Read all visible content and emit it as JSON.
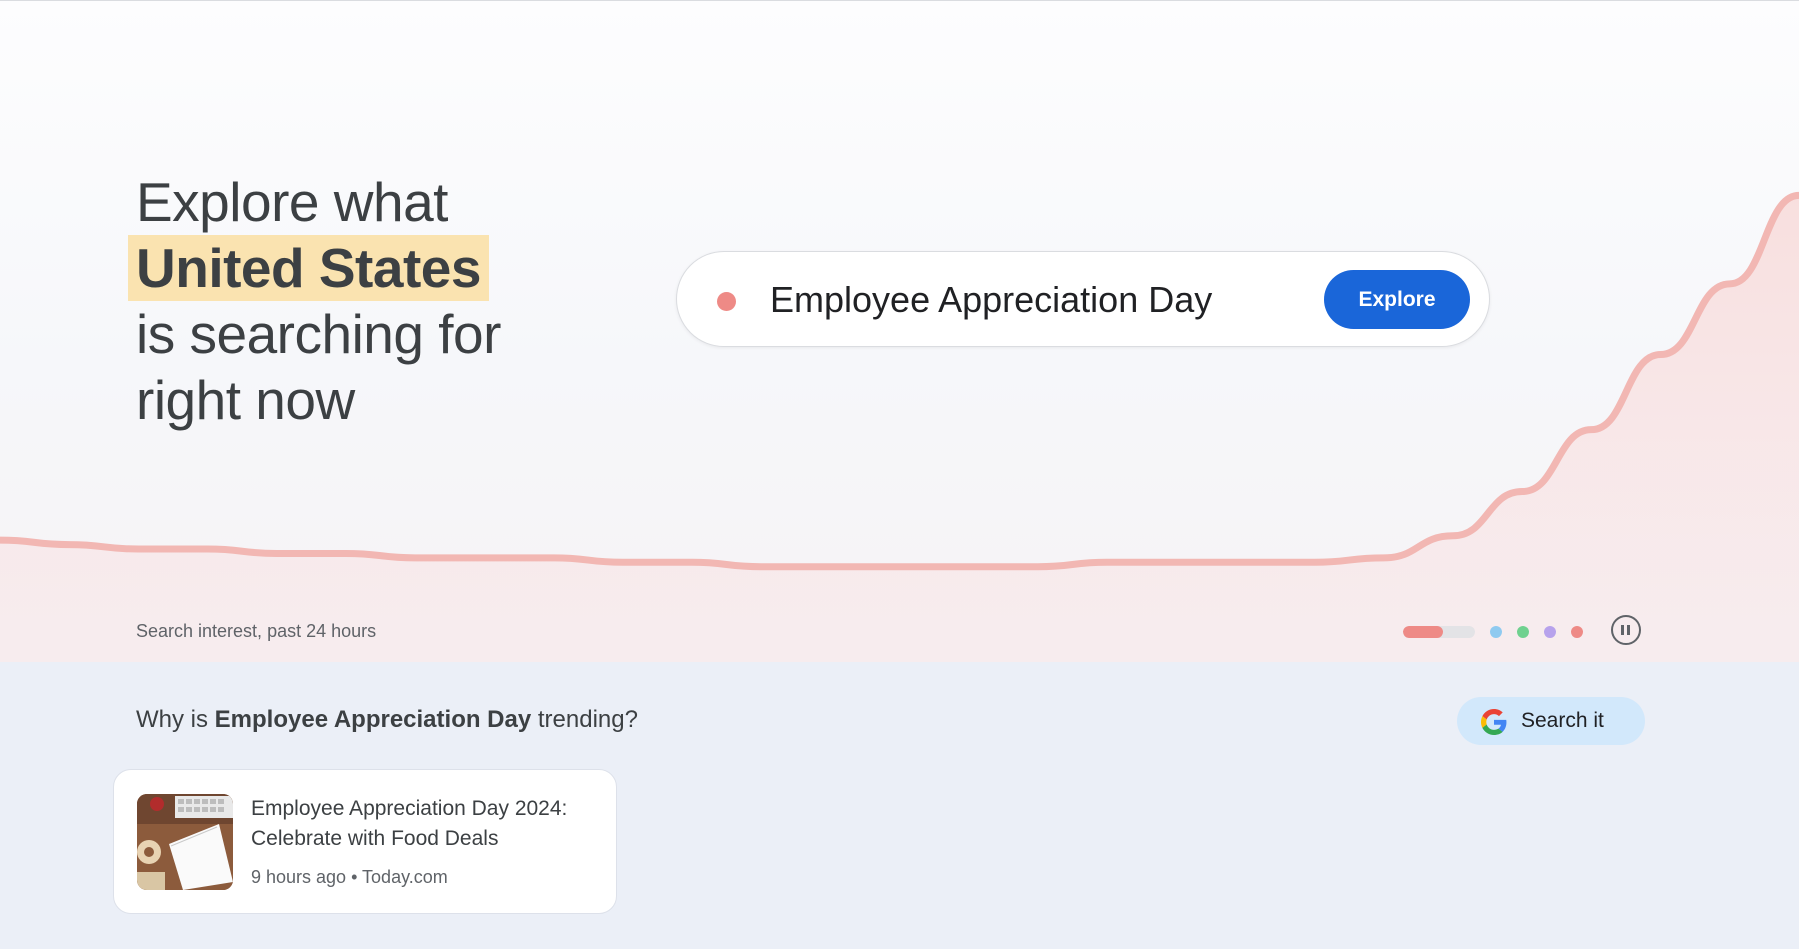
{
  "hero": {
    "headline_prefix": "Explore what",
    "location": "United States",
    "headline_middle": "is searching for",
    "headline_suffix": "right now",
    "search_term": "Employee Appreciation Day",
    "explore_label": "Explore",
    "caption": "Search interest, past 24 hours"
  },
  "trend": {
    "line_color": "#f2b7b3",
    "fill_color": "#f9e2e1",
    "values": [
      0.21,
      0.2,
      0.19,
      0.19,
      0.18,
      0.18,
      0.17,
      0.17,
      0.17,
      0.16,
      0.16,
      0.15,
      0.15,
      0.15,
      0.15,
      0.15,
      0.16,
      0.16,
      0.16,
      0.16,
      0.17,
      0.22,
      0.32,
      0.46,
      0.63,
      0.79,
      0.99
    ]
  },
  "carousel": {
    "progress": 0.55,
    "progress_color": "#ee8a86",
    "dot_colors": [
      "#8fcaf0",
      "#6fd18f",
      "#b7a2ec",
      "#ee8a86"
    ],
    "pause_icon": "pause-icon"
  },
  "trending": {
    "question_prefix": "Why is",
    "question_term": "Employee Appreciation Day",
    "question_suffix": "trending?",
    "search_it_label": "Search it",
    "search_it_icon": "google-g-icon"
  },
  "news": [
    {
      "title": "Employee Appreciation Day 2024: Celebrate with Food Deals",
      "meta": "9 hours ago • Today.com"
    }
  ],
  "colors": {
    "accent_blue": "#1a66d9",
    "highlight": "#fae3b0",
    "lower_bg": "#ebeff7"
  }
}
